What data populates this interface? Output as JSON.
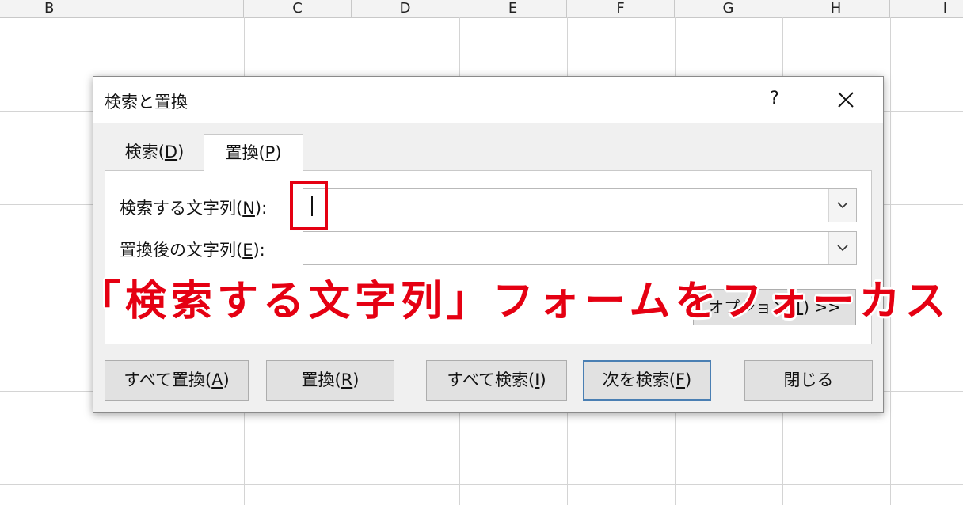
{
  "spreadsheet": {
    "columns": [
      "B",
      "C",
      "D",
      "E",
      "F",
      "G",
      "H",
      "I"
    ]
  },
  "dialog": {
    "title": "検索と置換",
    "help_label": "?",
    "close_label": "✕",
    "tabs": [
      {
        "label_pre": "検索(",
        "hotkey": "D",
        "label_post": ")"
      },
      {
        "label_pre": "置換(",
        "hotkey": "P",
        "label_post": ")"
      }
    ],
    "find_label_pre": "検索する文字列(",
    "find_hotkey": "N",
    "find_label_post": "):",
    "find_value": "",
    "replace_label_pre": "置換後の文字列(",
    "replace_hotkey": "E",
    "replace_label_post": "):",
    "replace_value": "",
    "options_label_pre": "オプション(",
    "options_hotkey": "T",
    "options_label_post": ") >>",
    "buttons": [
      {
        "label_pre": "すべて置換(",
        "hotkey": "A",
        "label_post": ")"
      },
      {
        "label_pre": "置換(",
        "hotkey": "R",
        "label_post": ")"
      },
      {
        "label_pre": "すべて検索(",
        "hotkey": "I",
        "label_post": ")"
      },
      {
        "label_pre": "次を検索(",
        "hotkey": "F",
        "label_post": ")"
      },
      {
        "label": "閉じる"
      }
    ]
  },
  "annotation": {
    "text": "「検索する文字列」フォームをフォーカス",
    "color": "#e50012"
  }
}
